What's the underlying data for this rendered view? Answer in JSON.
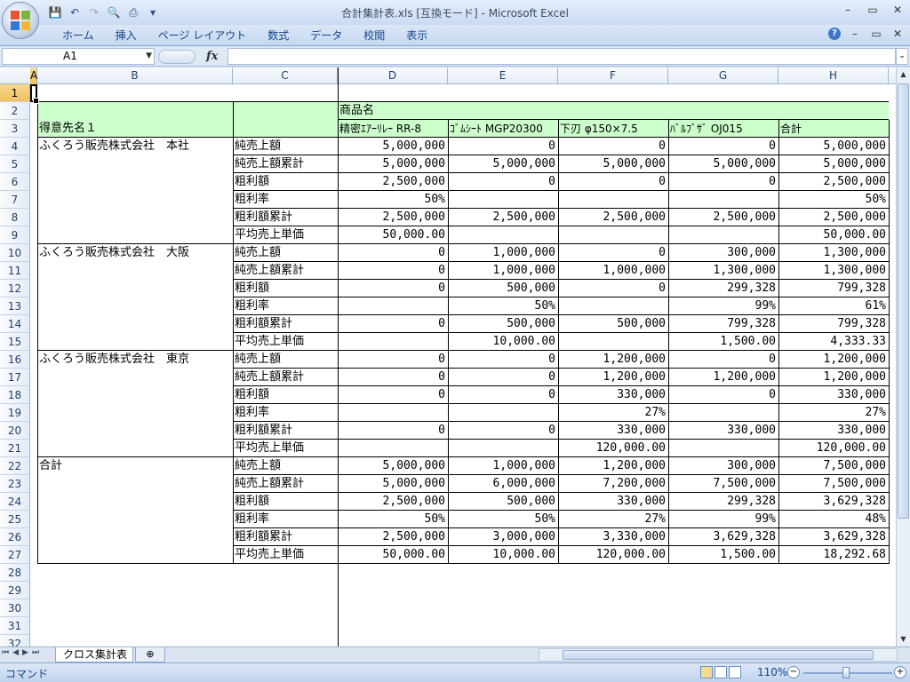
{
  "window": {
    "title": "合計集計表.xls [互換モード] - Microsoft Excel"
  },
  "window_controls": [
    "–",
    "▭",
    "✕"
  ],
  "quick_access": [
    "save-icon",
    "undo-icon",
    "redo-icon",
    "print-preview-icon",
    "print-icon",
    "customize-icon"
  ],
  "ribbon": {
    "tabs": [
      "ホーム",
      "挿入",
      "ページ レイアウト",
      "数式",
      "データ",
      "校閲",
      "表示"
    ],
    "right_controls": [
      "?",
      "–",
      "▭",
      "✕"
    ]
  },
  "formula_bar": {
    "name_box": "A1",
    "fx_label": "fx",
    "formula": ""
  },
  "columns": [
    "A",
    "B",
    "C",
    "D",
    "E",
    "F",
    "G",
    "H"
  ],
  "rows": [
    "1",
    "2",
    "3",
    "4",
    "5",
    "6",
    "7",
    "8",
    "9",
    "10",
    "11",
    "12",
    "13",
    "14",
    "15",
    "16",
    "17",
    "18",
    "19",
    "20",
    "21",
    "22",
    "23",
    "24",
    "25",
    "26",
    "27",
    "28",
    "29",
    "30",
    "31",
    "32"
  ],
  "table": {
    "header": {
      "product_label": "商品名",
      "customer_label": "得意先名１",
      "products": [
        "精密ｴｱｰﾘﾚｰ RR-8",
        "ｺﾞﾑｼｰﾄ MGP20300",
        "下刃 φ150×7.5",
        "ﾊﾞﾙﾌﾞｻﾞ OJ015",
        "合計"
      ]
    },
    "rows": [
      {
        "customer": "ふくろう販売株式会社　本社",
        "metric": "純売上額",
        "values": [
          "5,000,000",
          "0",
          "0",
          "0",
          "5,000,000"
        ]
      },
      {
        "customer": "",
        "metric": "純売上額累計",
        "values": [
          "5,000,000",
          "5,000,000",
          "5,000,000",
          "5,000,000",
          "5,000,000"
        ]
      },
      {
        "customer": "",
        "metric": "粗利額",
        "values": [
          "2,500,000",
          "0",
          "0",
          "0",
          "2,500,000"
        ]
      },
      {
        "customer": "",
        "metric": "粗利率",
        "values": [
          "50%",
          "",
          "",
          "",
          "50%"
        ]
      },
      {
        "customer": "",
        "metric": "粗利額累計",
        "values": [
          "2,500,000",
          "2,500,000",
          "2,500,000",
          "2,500,000",
          "2,500,000"
        ]
      },
      {
        "customer": "",
        "metric": "平均売上単価",
        "values": [
          "50,000.00",
          "",
          "",
          "",
          "50,000.00"
        ]
      },
      {
        "customer": "ふくろう販売株式会社　大阪",
        "metric": "純売上額",
        "values": [
          "0",
          "1,000,000",
          "0",
          "300,000",
          "1,300,000"
        ]
      },
      {
        "customer": "",
        "metric": "純売上額累計",
        "values": [
          "0",
          "1,000,000",
          "1,000,000",
          "1,300,000",
          "1,300,000"
        ]
      },
      {
        "customer": "",
        "metric": "粗利額",
        "values": [
          "0",
          "500,000",
          "0",
          "299,328",
          "799,328"
        ]
      },
      {
        "customer": "",
        "metric": "粗利率",
        "values": [
          "",
          "50%",
          "",
          "99%",
          "61%"
        ]
      },
      {
        "customer": "",
        "metric": "粗利額累計",
        "values": [
          "0",
          "500,000",
          "500,000",
          "799,328",
          "799,328"
        ]
      },
      {
        "customer": "",
        "metric": "平均売上単価",
        "values": [
          "",
          "10,000.00",
          "",
          "1,500.00",
          "4,333.33"
        ]
      },
      {
        "customer": "ふくろう販売株式会社　東京",
        "metric": "純売上額",
        "values": [
          "0",
          "0",
          "1,200,000",
          "0",
          "1,200,000"
        ]
      },
      {
        "customer": "",
        "metric": "純売上額累計",
        "values": [
          "0",
          "0",
          "1,200,000",
          "1,200,000",
          "1,200,000"
        ]
      },
      {
        "customer": "",
        "metric": "粗利額",
        "values": [
          "0",
          "0",
          "330,000",
          "0",
          "330,000"
        ]
      },
      {
        "customer": "",
        "metric": "粗利率",
        "values": [
          "",
          "",
          "27%",
          "",
          "27%"
        ]
      },
      {
        "customer": "",
        "metric": "粗利額累計",
        "values": [
          "0",
          "0",
          "330,000",
          "330,000",
          "330,000"
        ]
      },
      {
        "customer": "",
        "metric": "平均売上単価",
        "values": [
          "",
          "",
          "120,000.00",
          "",
          "120,000.00"
        ]
      },
      {
        "customer": "合計",
        "metric": "純売上額",
        "values": [
          "5,000,000",
          "1,000,000",
          "1,200,000",
          "300,000",
          "7,500,000"
        ]
      },
      {
        "customer": "",
        "metric": "純売上額累計",
        "values": [
          "5,000,000",
          "6,000,000",
          "7,200,000",
          "7,500,000",
          "7,500,000"
        ]
      },
      {
        "customer": "",
        "metric": "粗利額",
        "values": [
          "2,500,000",
          "500,000",
          "330,000",
          "299,328",
          "3,629,328"
        ]
      },
      {
        "customer": "",
        "metric": "粗利率",
        "values": [
          "50%",
          "50%",
          "27%",
          "99%",
          "48%"
        ]
      },
      {
        "customer": "",
        "metric": "粗利額累計",
        "values": [
          "2,500,000",
          "3,000,000",
          "3,330,000",
          "3,629,328",
          "3,629,328"
        ]
      },
      {
        "customer": "",
        "metric": "平均売上単価",
        "values": [
          "50,000.00",
          "10,000.00",
          "120,000.00",
          "1,500.00",
          "18,292.68"
        ]
      }
    ]
  },
  "sheet_tabs": {
    "active": "クロス集計表",
    "insert_icon": "insert-sheet-icon"
  },
  "status_bar": {
    "mode": "コマンド",
    "zoom": "110%"
  },
  "colors": {
    "header_fill": "#ccffcc",
    "selection": "#f1c15f"
  }
}
